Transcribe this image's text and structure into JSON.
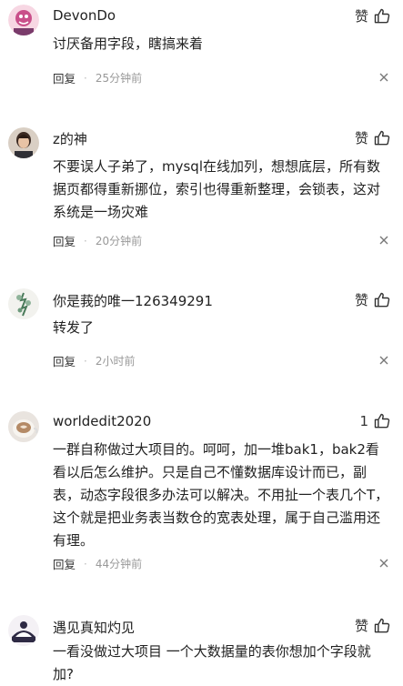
{
  "comments": [
    {
      "user": "DevonDo",
      "text": "讨厌备用字段，瞎搞来着",
      "reply_label": "回复",
      "time": "25分钟前",
      "like": "赞"
    },
    {
      "user": "z的神",
      "text": "不要误人子弟了，mysql在线加列，想想底层，所有数据页都得重新挪位，索引也得重新整理，会锁表，这对系统是一场灾难",
      "reply_label": "回复",
      "time": "20分钟前",
      "like": "赞"
    },
    {
      "user": "你是莪的唯一126349291",
      "text": "转发了",
      "reply_label": "回复",
      "time": "2小时前",
      "like": "赞"
    },
    {
      "user": "worldedit2020",
      "text": "一群自称做过大项目的。呵呵，加一堆bak1，bak2看看以后怎么维护。只是自己不懂数据库设计而已，副表，动态字段很多办法可以解决。不用扯一个表几个T，这个就是把业务表当数仓的宽表处理，属于自己滥用还有理。",
      "reply_label": "回复",
      "time": "44分钟前",
      "like": "1"
    },
    {
      "user": "遇见真知灼见",
      "text": "一看没做过大项目 一个大数据量的表你想加个字段就加?",
      "like": "赞"
    }
  ],
  "colors": {
    "text": "#222222",
    "meta": "#999999",
    "background": "#ffffff"
  },
  "icons": {
    "like": "thumbs-up-icon",
    "more": "close-icon"
  }
}
